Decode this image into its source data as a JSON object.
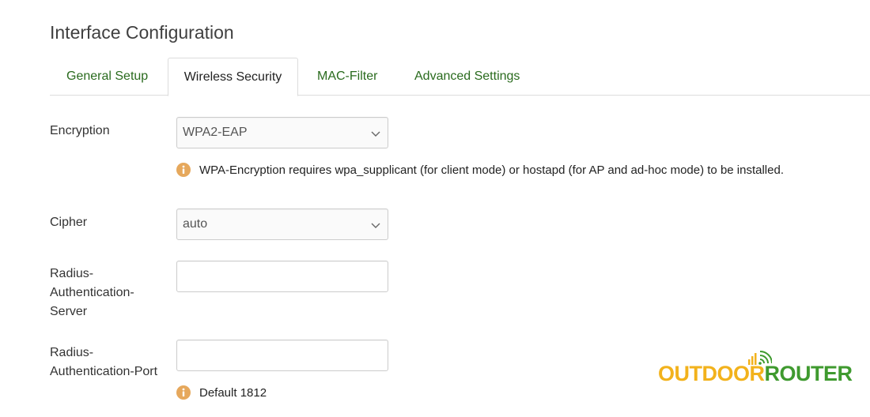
{
  "page": {
    "title": "Interface Configuration"
  },
  "tabs": [
    {
      "label": "General Setup",
      "active": false
    },
    {
      "label": "Wireless Security",
      "active": true
    },
    {
      "label": "MAC-Filter",
      "active": false
    },
    {
      "label": "Advanced Settings",
      "active": false
    }
  ],
  "form": {
    "encryption": {
      "label": "Encryption",
      "value": "WPA2-EAP",
      "hint": "WPA-Encryption requires wpa_supplicant (for client mode) or hostapd (for AP and ad-hoc mode) to be installed."
    },
    "cipher": {
      "label": "Cipher",
      "value": "auto"
    },
    "radius_server": {
      "label": "Radius-Authentication-Server",
      "value": ""
    },
    "radius_port": {
      "label": "Radius-Authentication-Port",
      "value": "",
      "hint": "Default 1812"
    }
  },
  "logo": {
    "part1": "OUTDOOR",
    "part2": "ROUTER"
  },
  "colors": {
    "tab_link": "#2a6b1e",
    "info_icon": "#e6a85c",
    "logo_orange": "#f2b21c",
    "logo_green": "#3f9a2f"
  },
  "icons": {
    "select_arrow": "chevron-down-icon",
    "hint": "info-icon",
    "logo_signal": "wifi-signal-icon"
  }
}
